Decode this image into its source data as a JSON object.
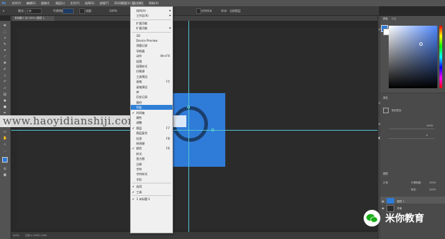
{
  "menubar": {
    "items": [
      "Ps",
      "文件(F)",
      "编辑(E)",
      "图像(I)",
      "图层(L)",
      "文字(Y)",
      "选择(S)",
      "滤镜(T)",
      "3D(D)",
      "视图(V)",
      "窗口(W)",
      "帮助(H)"
    ]
  },
  "options_bar": {
    "mode_label": "模式:",
    "mode_value": "正常",
    "opacity_label": "不透明度:",
    "opacity_value": "100%",
    "flow_label": "流量:",
    "flow_value": "100%",
    "align_label": "对齐样本",
    "sample_label": "样本:",
    "sample_value": "当前图层"
  },
  "document_tab": {
    "label": "未标题-1 @ 100% (图层 1, RGB/8)"
  },
  "status_bar": {
    "zoom": "100%",
    "doc_info": "文档:1.32M/1.45M"
  },
  "watermark": "www.haoyidianshiji.com",
  "wechat": {
    "name": "米你教育"
  },
  "panels": {
    "color_tab": "颜色",
    "swatch_tab": "色板",
    "adjust_title": "属性",
    "adjust_sub": "渐变叠加",
    "slider_value_1": "100%",
    "slider_value_2": "0",
    "layers_tab": "图层",
    "layer_kind": "正常",
    "layer_opacity_label": "不透明度:",
    "layer_opacity": "100%",
    "layer_fill_label": "填充:",
    "layer_fill": "100%",
    "layer1_name": "图层 1",
    "layerbg_name": "背景"
  },
  "colors": {
    "accent": "#2f7bd8",
    "highlight": "#2f7fd6",
    "guide": "#52c5d2"
  },
  "window_menu": {
    "items": [
      {
        "label": "排列(A)",
        "arrow": true
      },
      {
        "label": "工作区(K)",
        "arrow": true
      },
      {
        "sep": true
      },
      {
        "label": "扩展功能"
      },
      {
        "label": "扩展功能",
        "arrow": true
      },
      {
        "sep": true
      },
      {
        "label": "3D"
      },
      {
        "label": "Device Preview"
      },
      {
        "label": "测量记录"
      },
      {
        "label": "导航器"
      },
      {
        "label": "动作",
        "shortcut": "Alt+F9"
      },
      {
        "label": "段落"
      },
      {
        "label": "段落样式"
      },
      {
        "label": "仿制源"
      },
      {
        "label": "工具预设"
      },
      {
        "label": "画笔",
        "shortcut": "F5"
      },
      {
        "label": "画笔预设"
      },
      {
        "label": "库"
      },
      {
        "label": "历史记录"
      },
      {
        "label": "路径"
      },
      {
        "label": "色板",
        "highlight": true
      },
      {
        "label": "时间轴",
        "checked": true
      },
      {
        "label": "属性"
      },
      {
        "label": "调整"
      },
      {
        "label": "图层",
        "shortcut": "F7",
        "checked": true
      },
      {
        "label": "图层复合"
      },
      {
        "label": "信息",
        "shortcut": "F8"
      },
      {
        "label": "修改键"
      },
      {
        "label": "颜色",
        "shortcut": "F6",
        "checked": true
      },
      {
        "label": "样式"
      },
      {
        "label": "直方图"
      },
      {
        "label": "注释"
      },
      {
        "label": "字符"
      },
      {
        "label": "字符样式"
      },
      {
        "label": "字形"
      },
      {
        "sep": true
      },
      {
        "label": "选项",
        "checked": true
      },
      {
        "label": "工具",
        "checked": true
      },
      {
        "sep": true
      },
      {
        "label": "1 未标题-1",
        "checked": true
      }
    ]
  }
}
